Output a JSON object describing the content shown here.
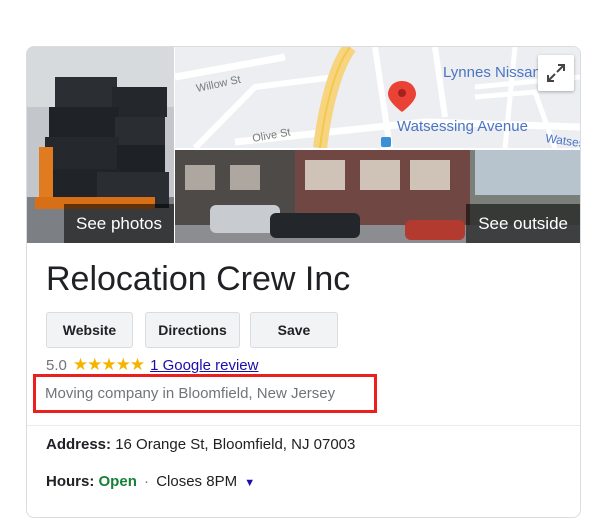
{
  "photos": {
    "left_label": "See photos",
    "right_label": "See outside"
  },
  "map": {
    "labels": [
      "Willow St",
      "Lynnes Nissan C",
      "Olive St",
      "Watsessing Avenue",
      "Watsessin"
    ]
  },
  "business": {
    "name": "Relocation Crew Inc",
    "rating": "5.0",
    "stars": "★★★★★",
    "review_link": "1 Google review",
    "category": "Moving company in Bloomfield, New Jersey"
  },
  "actions": {
    "website": "Website",
    "directions": "Directions",
    "save": "Save"
  },
  "info": {
    "address_label": "Address:",
    "address_value": "16 Orange St, Bloomfield, NJ 07003",
    "hours_label": "Hours:",
    "hours_status": "Open",
    "hours_sep": "·",
    "hours_close": "Closes 8PM"
  },
  "colors": {
    "accent_red": "#ec1f1f",
    "link": "#1a0dab",
    "open_green": "#188038",
    "star": "#f4b400"
  }
}
